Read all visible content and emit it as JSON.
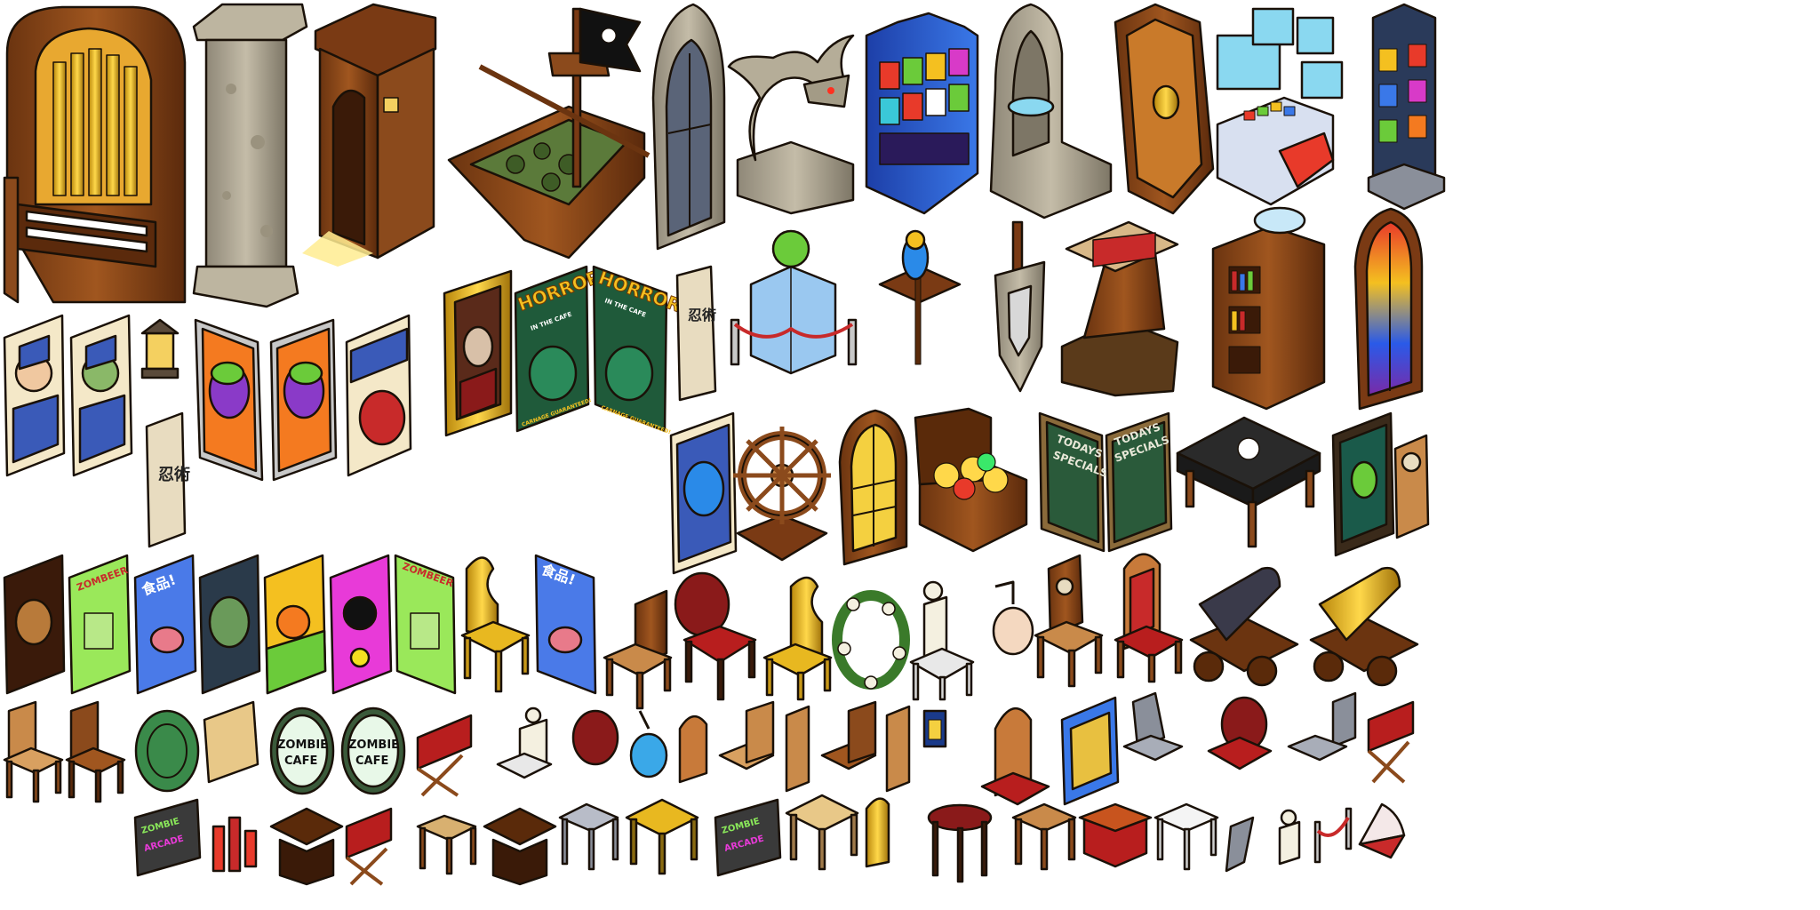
{
  "poster_horror": {
    "word": "HORROR",
    "sub": "IN THE CAFE",
    "tag": "CARNAGE GUARANTEED!"
  },
  "poster_zombeer": {
    "word": "ZOMBEER"
  },
  "poster_food": {
    "word": "食品!"
  },
  "scroll": {
    "word": "忍術"
  },
  "menu_board": {
    "line1": "TODAYS",
    "line2": "SPECIALS"
  },
  "sign_cafe": {
    "line1": "ZOMBIE",
    "line2": "CAFE"
  },
  "sign_arcade": {
    "line1": "ZOMBIE",
    "line2": "ARCADE"
  },
  "colors": {
    "wood": "#8B4A1C",
    "wood_light": "#C98A4A",
    "stone": "#A89F8A",
    "gold": "#E8B820",
    "red": "#B81E1E",
    "green_poster": "#6BCB3A",
    "blue_machine": "#2B5BD8",
    "outline": "#1a1108"
  }
}
